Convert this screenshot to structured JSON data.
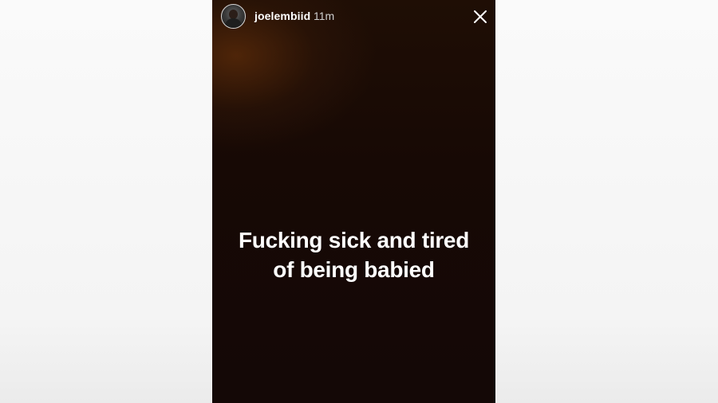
{
  "story": {
    "username": "joelembiid",
    "timestamp": "11m",
    "caption_line1": "Fucking sick and tired",
    "caption_line2": "of being babied"
  },
  "icons": {
    "close": "close-icon",
    "avatar": "avatar"
  },
  "colors": {
    "background": "#f7f7f7",
    "story_bg": "#160906",
    "story_glow": "#5f2d0a",
    "text": "#ffffff"
  }
}
